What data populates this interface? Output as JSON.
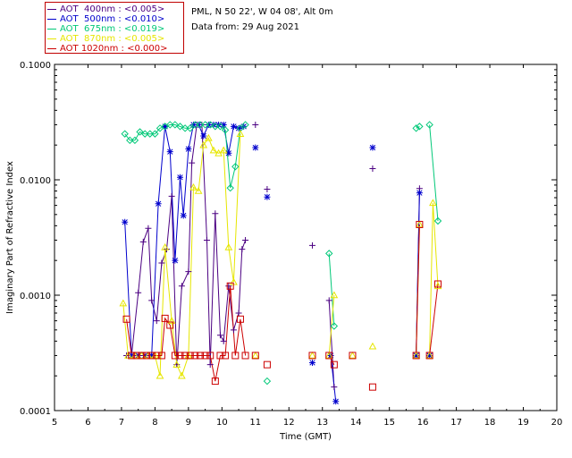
{
  "header": {
    "site": "PML, N 50 22', W 04 08', Alt 0m",
    "date": "Data from: 29 Aug 2021"
  },
  "legend": [
    {
      "label": "AOT  400nm : <0.005>",
      "color": "#4b0082"
    },
    {
      "label": "AOT  500nm : <0.010>",
      "color": "#0000cd"
    },
    {
      "label": "AOT  675nm : <0.019>",
      "color": "#00c878"
    },
    {
      "label": "AOT  870nm : <0.005>",
      "color": "#e6e600"
    },
    {
      "label": "AOT 1020nm : <0.000>",
      "color": "#cc0000"
    }
  ],
  "chart_data": {
    "type": "line",
    "title": "",
    "xlabel": "Time (GMT)",
    "ylabel": "Imaginary Part of Refractive Index",
    "xlim": [
      5,
      20
    ],
    "ylim": [
      0.0001,
      0.1
    ],
    "yscale": "log",
    "xticks": [
      "5",
      "6",
      "7",
      "8",
      "9",
      "10",
      "11",
      "12",
      "13",
      "14",
      "15",
      "16",
      "17",
      "18",
      "19",
      "20"
    ],
    "yticks": [
      "0.0001",
      "0.0010",
      "0.0100",
      "0.1000"
    ],
    "grid": false,
    "series": [
      {
        "name": "AOT  400nm : <0.005>",
        "color": "#4b0082",
        "marker": "plus",
        "segments": [
          [
            [
              7.15,
              0.0003
            ],
            [
              7.3,
              0.0003
            ],
            [
              7.5,
              0.00105
            ],
            [
              7.65,
              0.0029
            ],
            [
              7.8,
              0.0038
            ],
            [
              7.9,
              0.0009
            ],
            [
              8.05,
              0.0006
            ],
            [
              8.2,
              0.0019
            ],
            [
              8.35,
              0.0025
            ],
            [
              8.5,
              0.0072
            ],
            [
              8.65,
              0.00025
            ],
            [
              8.8,
              0.0012
            ],
            [
              9.0,
              0.0016
            ],
            [
              9.1,
              0.014
            ],
            [
              9.25,
              0.03
            ],
            [
              9.4,
              0.03
            ],
            [
              9.55,
              0.003
            ],
            [
              9.65,
              0.00025
            ],
            [
              9.8,
              0.0051
            ],
            [
              9.95,
              0.00045
            ],
            [
              10.05,
              0.0004
            ],
            [
              10.2,
              0.0012
            ],
            [
              10.35,
              0.0005
            ],
            [
              10.5,
              0.0007
            ],
            [
              10.6,
              0.0025
            ],
            [
              10.7,
              0.003
            ]
          ],
          [
            [
              11.0,
              0.03
            ]
          ],
          [
            [
              11.35,
              0.0083
            ]
          ],
          [
            [
              12.7,
              0.0027
            ]
          ],
          [
            [
              13.2,
              0.0009
            ],
            [
              13.35,
              0.00016
            ]
          ],
          [
            [
              14.5,
              0.0125
            ]
          ],
          [
            [
              15.8,
              0.0003
            ],
            [
              15.9,
              0.0084
            ]
          ],
          [
            [
              16.2,
              0.0003
            ]
          ]
        ]
      },
      {
        "name": "AOT  500nm : <0.010>",
        "color": "#0000cd",
        "marker": "star",
        "segments": [
          [
            [
              7.1,
              0.0043
            ],
            [
              7.3,
              0.0003
            ],
            [
              7.5,
              0.0003
            ],
            [
              7.7,
              0.0003
            ],
            [
              7.9,
              0.0003
            ],
            [
              8.1,
              0.0062
            ],
            [
              8.3,
              0.029
            ],
            [
              8.45,
              0.0175
            ],
            [
              8.6,
              0.002
            ],
            [
              8.75,
              0.0105
            ],
            [
              8.85,
              0.0049
            ],
            [
              9.0,
              0.0185
            ],
            [
              9.15,
              0.03
            ],
            [
              9.3,
              0.03
            ],
            [
              9.45,
              0.024
            ],
            [
              9.6,
              0.03
            ],
            [
              9.75,
              0.03
            ],
            [
              9.9,
              0.03
            ],
            [
              10.05,
              0.03
            ],
            [
              10.2,
              0.017
            ],
            [
              10.35,
              0.029
            ],
            [
              10.5,
              0.028
            ],
            [
              10.65,
              0.029
            ]
          ],
          [
            [
              11.0,
              0.019
            ]
          ],
          [
            [
              11.35,
              0.0071
            ]
          ],
          [
            [
              12.7,
              0.00026
            ]
          ],
          [
            [
              13.25,
              0.0003
            ],
            [
              13.4,
              0.00012
            ]
          ],
          [
            [
              14.5,
              0.019
            ]
          ],
          [
            [
              15.8,
              0.0003
            ],
            [
              15.9,
              0.0077
            ]
          ],
          [
            [
              16.2,
              0.0003
            ]
          ]
        ]
      },
      {
        "name": "AOT  675nm : <0.019>",
        "color": "#00c878",
        "marker": "diamond",
        "segments": [
          [
            [
              7.1,
              0.025
            ],
            [
              7.25,
              0.022
            ],
            [
              7.4,
              0.022
            ],
            [
              7.55,
              0.026
            ],
            [
              7.7,
              0.025
            ],
            [
              7.85,
              0.025
            ],
            [
              8.0,
              0.025
            ],
            [
              8.15,
              0.028
            ],
            [
              8.3,
              0.029
            ],
            [
              8.45,
              0.03
            ],
            [
              8.6,
              0.03
            ],
            [
              8.75,
              0.029
            ],
            [
              8.9,
              0.028
            ],
            [
              9.05,
              0.028
            ],
            [
              9.2,
              0.03
            ],
            [
              9.35,
              0.03
            ],
            [
              9.5,
              0.03
            ],
            [
              9.65,
              0.03
            ],
            [
              9.8,
              0.029
            ],
            [
              9.95,
              0.029
            ],
            [
              10.1,
              0.027
            ],
            [
              10.25,
              0.0085
            ],
            [
              10.4,
              0.013
            ],
            [
              10.55,
              0.028
            ],
            [
              10.7,
              0.03
            ]
          ],
          [
            [
              11.35,
              0.00018
            ]
          ],
          [
            [
              13.2,
              0.0023
            ],
            [
              13.35,
              0.00054
            ]
          ],
          [
            [
              15.8,
              0.028
            ],
            [
              15.9,
              0.029
            ]
          ],
          [
            [
              16.2,
              0.03
            ],
            [
              16.45,
              0.0044
            ]
          ]
        ]
      },
      {
        "name": "AOT  870nm : <0.005>",
        "color": "#e6e600",
        "marker": "triangle",
        "segments": [
          [
            [
              7.05,
              0.00085
            ],
            [
              7.2,
              0.0003
            ],
            [
              7.4,
              0.0003
            ],
            [
              7.6,
              0.0003
            ],
            [
              7.8,
              0.0003
            ],
            [
              8.0,
              0.0003
            ],
            [
              8.15,
              0.0002
            ],
            [
              8.3,
              0.0026
            ],
            [
              8.5,
              0.0006
            ],
            [
              8.65,
              0.00025
            ],
            [
              8.8,
              0.0002
            ],
            [
              9.0,
              0.0003
            ],
            [
              9.15,
              0.0086
            ],
            [
              9.3,
              0.008
            ],
            [
              9.45,
              0.02
            ],
            [
              9.6,
              0.023
            ],
            [
              9.75,
              0.018
            ],
            [
              9.9,
              0.017
            ],
            [
              10.05,
              0.018
            ],
            [
              10.2,
              0.0026
            ],
            [
              10.35,
              0.0013
            ],
            [
              10.55,
              0.025
            ]
          ],
          [
            [
              11.0,
              0.0003
            ]
          ],
          [
            [
              12.7,
              0.0003
            ]
          ],
          [
            [
              13.2,
              0.0003
            ],
            [
              13.35,
              0.001
            ]
          ],
          [
            [
              13.9,
              0.0003
            ]
          ],
          [
            [
              14.5,
              0.00036
            ]
          ],
          [
            [
              15.8,
              0.0003
            ],
            [
              15.9,
              0.0041
            ]
          ],
          [
            [
              16.2,
              0.0003
            ],
            [
              16.3,
              0.0063
            ],
            [
              16.45,
              0.0012
            ]
          ]
        ]
      },
      {
        "name": "AOT 1020nm : <0.000>",
        "color": "#cc0000",
        "marker": "square",
        "segments": [
          [
            [
              7.15,
              0.00062
            ],
            [
              7.3,
              0.0003
            ],
            [
              7.45,
              0.0003
            ],
            [
              7.6,
              0.0003
            ],
            [
              7.75,
              0.0003
            ],
            [
              7.9,
              0.0003
            ],
            [
              8.05,
              0.0003
            ],
            [
              8.2,
              0.0003
            ],
            [
              8.3,
              0.00063
            ],
            [
              8.45,
              0.00055
            ],
            [
              8.6,
              0.0003
            ],
            [
              8.75,
              0.0003
            ],
            [
              8.9,
              0.0003
            ],
            [
              9.05,
              0.0003
            ],
            [
              9.2,
              0.0003
            ],
            [
              9.35,
              0.0003
            ],
            [
              9.5,
              0.0003
            ],
            [
              9.65,
              0.0003
            ],
            [
              9.8,
              0.00018
            ],
            [
              9.95,
              0.0003
            ],
            [
              10.1,
              0.0003
            ],
            [
              10.25,
              0.0012
            ],
            [
              10.4,
              0.0003
            ],
            [
              10.55,
              0.00062
            ],
            [
              10.7,
              0.0003
            ]
          ],
          [
            [
              11.0,
              0.0003
            ]
          ],
          [
            [
              11.35,
              0.00025
            ]
          ],
          [
            [
              12.7,
              0.0003
            ]
          ],
          [
            [
              13.2,
              0.0003
            ],
            [
              13.35,
              0.00025
            ]
          ],
          [
            [
              13.9,
              0.0003
            ]
          ],
          [
            [
              14.5,
              0.00016
            ]
          ],
          [
            [
              15.8,
              0.0003
            ],
            [
              15.9,
              0.0041
            ]
          ],
          [
            [
              16.2,
              0.0003
            ],
            [
              16.45,
              0.00125
            ]
          ]
        ]
      }
    ]
  }
}
